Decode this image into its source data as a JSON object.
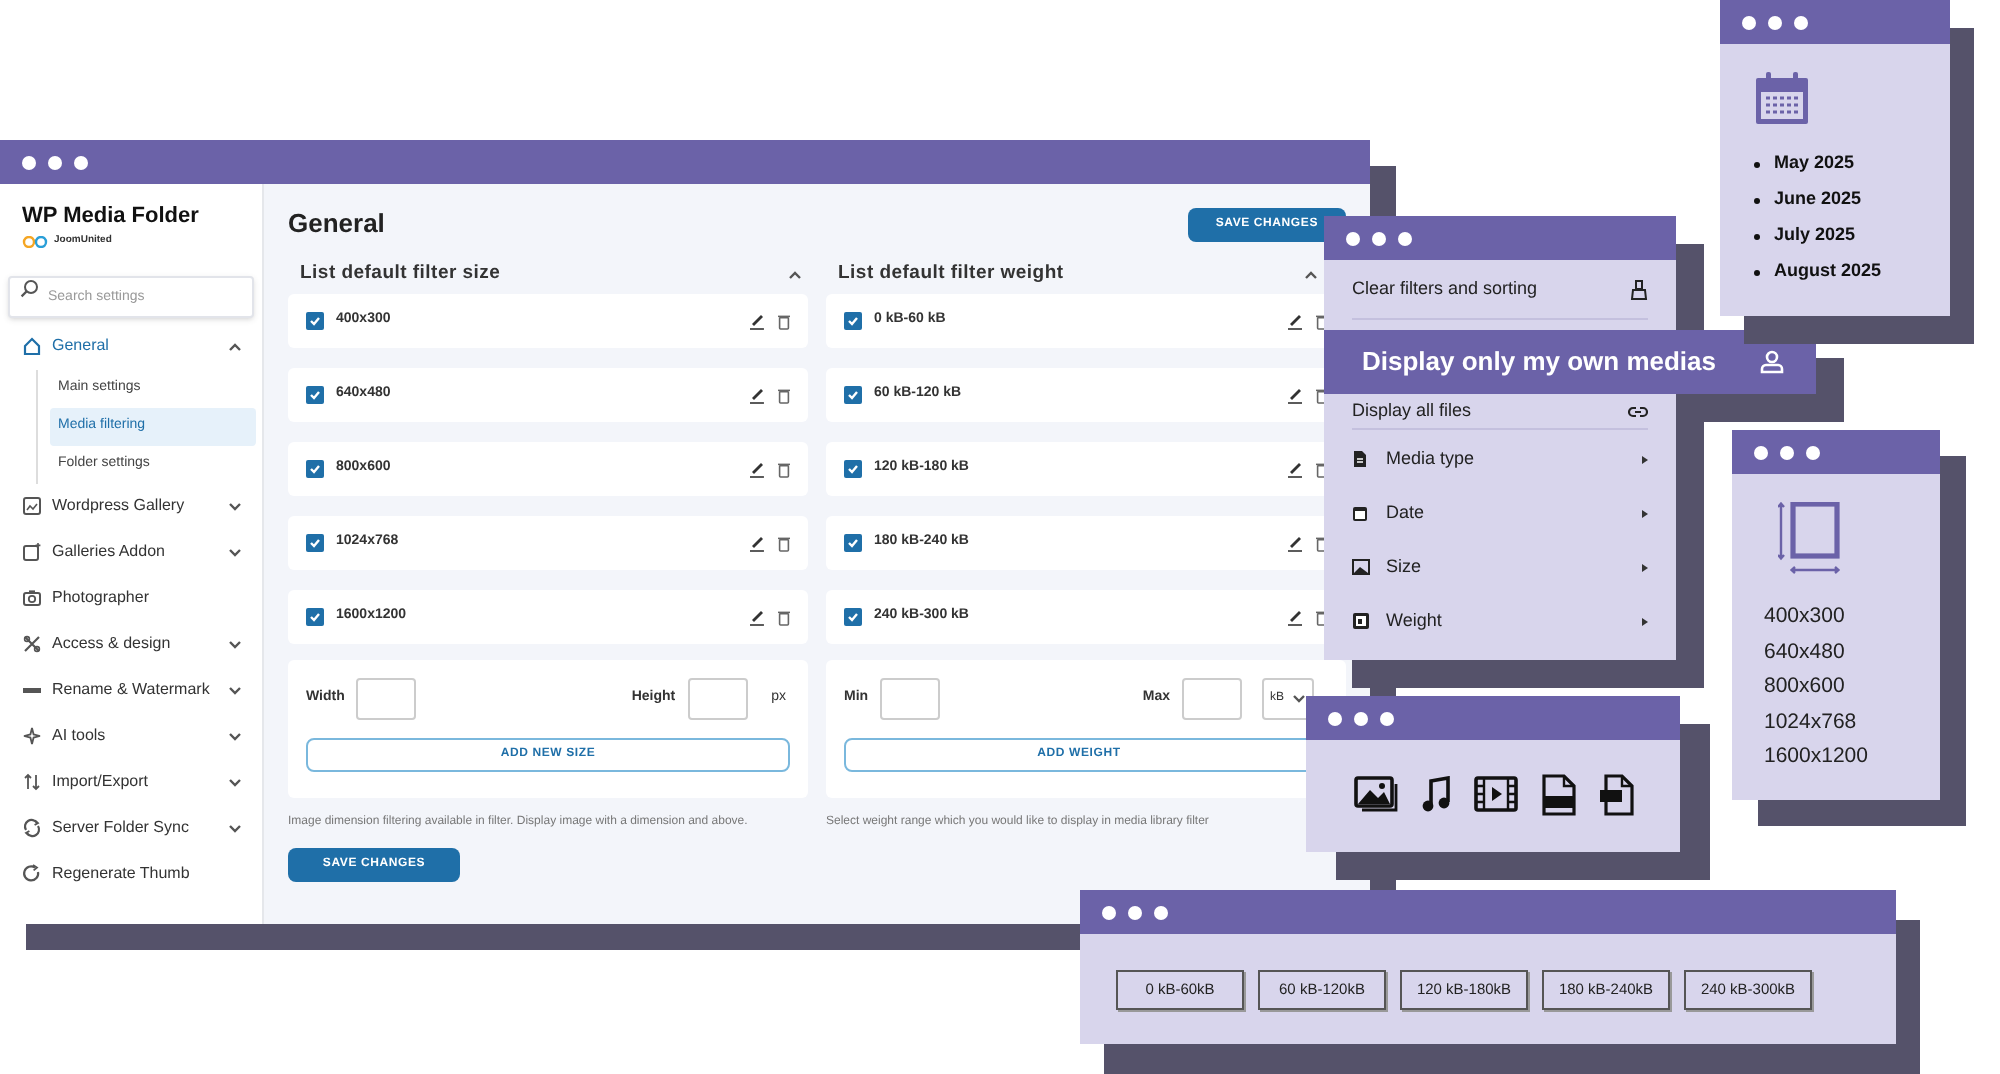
{
  "main_window": {
    "sidebar": {
      "title": "WP Media Folder",
      "brand": "JoomUnited",
      "search": {
        "placeholder": "Search settings"
      },
      "items": [
        {
          "label": "General",
          "kind": "group",
          "expanded": true,
          "selected": true,
          "children": [
            {
              "label": "Main settings",
              "selected": false
            },
            {
              "label": "Media filtering",
              "selected": true
            },
            {
              "label": "Folder settings",
              "selected": false
            }
          ]
        },
        {
          "label": "Wordpress Gallery",
          "kind": "group",
          "expanded": false,
          "selected": false
        },
        {
          "label": "Galleries Addon",
          "kind": "group",
          "expanded": false,
          "selected": false
        },
        {
          "label": "Photographer",
          "kind": "link",
          "selected": false
        },
        {
          "label": "Access & design",
          "kind": "group",
          "expanded": false,
          "selected": false
        },
        {
          "label": "Rename & Watermark",
          "kind": "group",
          "expanded": false,
          "selected": false
        },
        {
          "label": "AI tools",
          "kind": "group",
          "expanded": false,
          "selected": false
        },
        {
          "label": "Import/Export",
          "kind": "group",
          "expanded": false,
          "selected": false
        },
        {
          "label": "Server Folder Sync",
          "kind": "group",
          "expanded": false,
          "selected": false
        },
        {
          "label": "Regenerate Thumb",
          "kind": "link",
          "selected": false
        }
      ]
    },
    "title": "General",
    "save_button": "SAVE CHANGES",
    "panels": [
      {
        "title": "List default filter size",
        "expanded": true,
        "rows": [
          {
            "label": "400x300",
            "checked": true
          },
          {
            "label": "640x480",
            "checked": true
          },
          {
            "label": "800x600",
            "checked": true
          },
          {
            "label": "1024x768",
            "checked": true
          },
          {
            "label": "1600x1200",
            "checked": true
          }
        ],
        "fields": [
          {
            "label": "Width"
          },
          {
            "label": "Height"
          }
        ],
        "unit": {
          "kind": "text",
          "value": "px"
        },
        "add_button": "ADD NEW SIZE",
        "help": "Image dimension filtering available in filter. Display image with a dimension and above."
      },
      {
        "title": "List default filter weight",
        "expanded": true,
        "rows": [
          {
            "label": "0 kB-60 kB",
            "checked": true
          },
          {
            "label": "60 kB-120 kB",
            "checked": true
          },
          {
            "label": "120 kB-180 kB",
            "checked": true
          },
          {
            "label": "180 kB-240 kB",
            "checked": true
          },
          {
            "label": "240 kB-300 kB",
            "checked": true
          }
        ],
        "fields": [
          {
            "label": "Min"
          },
          {
            "label": "Max"
          }
        ],
        "unit": {
          "kind": "select",
          "value": "kB"
        },
        "add_button": "ADD WEIGHT",
        "help": "Select weight range which you would like to display in media library filter"
      }
    ],
    "footer_button": "SAVE CHANGES"
  },
  "filter_menu": {
    "items": [
      {
        "label": "Clear filters and sorting",
        "kind": "action"
      },
      {
        "label": "Display all files",
        "kind": "action"
      },
      {
        "label": "Media type",
        "kind": "submenu"
      },
      {
        "label": "Date",
        "kind": "submenu"
      },
      {
        "label": "Size",
        "kind": "submenu"
      },
      {
        "label": "Weight",
        "kind": "submenu"
      }
    ]
  },
  "callout": {
    "label": "Display only my own medias"
  },
  "date_window": {
    "months": [
      "May 2025",
      "June 2025",
      "July 2025",
      "August 2025"
    ]
  },
  "size_window": {
    "sizes": [
      "400x300",
      "640x480",
      "800x600",
      "1024x768",
      "1600x1200"
    ]
  },
  "weight_window": {
    "buttons": [
      "0 kB-60kB",
      "60 kB-120kB",
      "120 kB-180kB",
      "180 kB-240kB",
      "240 kB-300kB"
    ]
  }
}
